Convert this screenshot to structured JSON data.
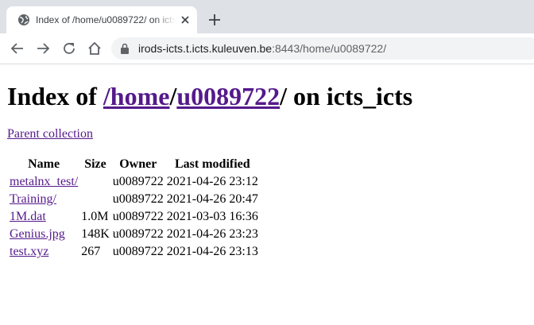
{
  "browser": {
    "tab": {
      "title": "Index of /home/u0089722/ on icts_icts",
      "favicon": "globe-icon"
    },
    "toolbar": {
      "url_host": "irods-icts.t.icts.kuleuven.be",
      "url_rest": ":8443/home/u0089722/"
    }
  },
  "page": {
    "heading": {
      "prefix": "Index of ",
      "link_home": "/home",
      "sep": "/",
      "link_user": "u0089722",
      "suffix": "/ on icts_icts"
    },
    "parent_link": "Parent collection",
    "table": {
      "headers": [
        "Name",
        "Size",
        "Owner",
        "Last modified"
      ],
      "rows": [
        {
          "name": "metalnx_test/",
          "size": "",
          "owner": "u0089722",
          "modified": "2021-04-26 23:12"
        },
        {
          "name": "Training/",
          "size": "",
          "owner": "u0089722",
          "modified": "2021-04-26 20:47"
        },
        {
          "name": "1M.dat",
          "size": "1.0M",
          "owner": "u0089722",
          "modified": "2021-03-03 16:36"
        },
        {
          "name": "Genius.jpg",
          "size": "148K",
          "owner": "u0089722",
          "modified": "2021-04-26 23:23"
        },
        {
          "name": "test.xyz",
          "size": "267",
          "owner": "u0089722",
          "modified": "2021-04-26 23:13"
        }
      ]
    }
  },
  "colors": {
    "link": "#551a8b",
    "tabstrip": "#dee1e6",
    "omnibox": "#f1f3f4"
  }
}
